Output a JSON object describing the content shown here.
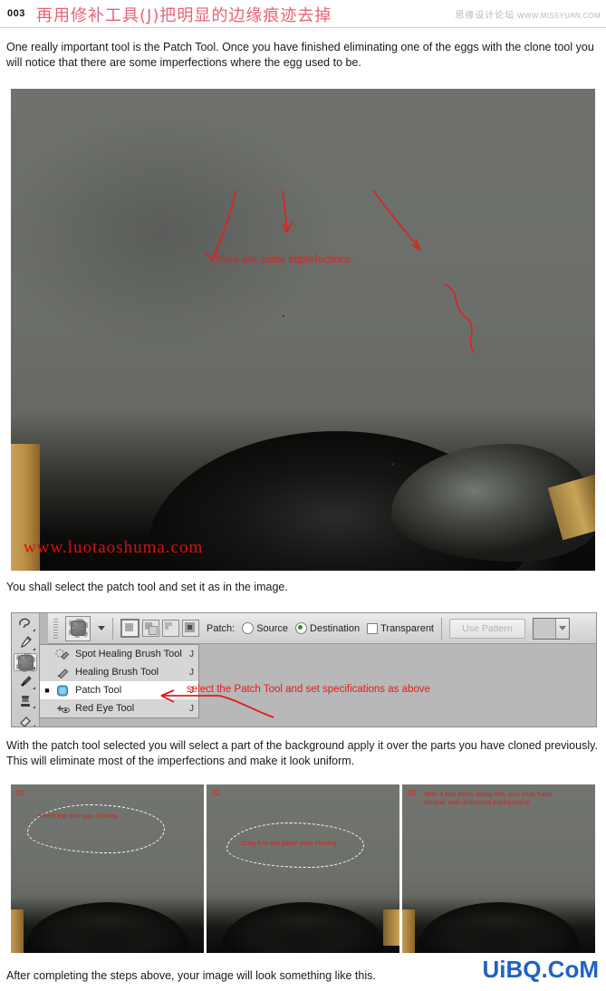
{
  "header": {
    "step_number": "003",
    "title": "再用修补工具(J)把明显的边缘痕迹去掉",
    "brand_cn": "思缘设计论坛",
    "brand_url": "WWW.MISSYUAN.COM"
  },
  "intro_paragraph": "One really important tool is the Patch Tool. Once you have finished eliminating one of the eggs with the clone tool you will notice that there are some imperfections where the egg used to be.",
  "photo1": {
    "annotation": "there are some imprefections.",
    "watermark": "www.luotaoshuma.com"
  },
  "caption_select_patch": "You shall select the patch tool and set it as in the image.",
  "photoshop": {
    "patch_label": "Patch:",
    "source_label": "Source",
    "destination_label": "Destination",
    "transparent_label": "Transparent",
    "use_pattern_label": "Use Pattern",
    "menu_items": [
      {
        "label": "Spot Healing Brush Tool",
        "shortcut": "J",
        "selected": false,
        "icon": "spot-healing-brush-icon"
      },
      {
        "label": "Healing Brush Tool",
        "shortcut": "J",
        "selected": false,
        "icon": "healing-brush-icon"
      },
      {
        "label": "Patch Tool",
        "shortcut": "J",
        "selected": true,
        "icon": "patch-tool-icon"
      },
      {
        "label": "Red Eye Tool",
        "shortcut": "J",
        "selected": false,
        "icon": "red-eye-icon"
      }
    ],
    "annotation": "select the Patch Tool and set specifications as above"
  },
  "body_paragraph": "With the patch tool selected you will select a part of the background apply it over the parts you have cloned previously. This will eliminate most of the imperfections and make it look uniform.",
  "steps": [
    {
      "number": "01",
      "note": "select the part you cloning"
    },
    {
      "number": "02",
      "note": "Drag it to the place your cloning"
    },
    {
      "number": "03",
      "note": "after a few times doing this, you shall have cleaner and uniformed background"
    }
  ],
  "footer_note": "After completing the steps above, your image will look something like this.",
  "site_logo": "UiBQ.CoM",
  "colors": {
    "title_red": "#e8607a",
    "annotation_red": "#e02020",
    "logo_blue": "#1e63c8"
  }
}
